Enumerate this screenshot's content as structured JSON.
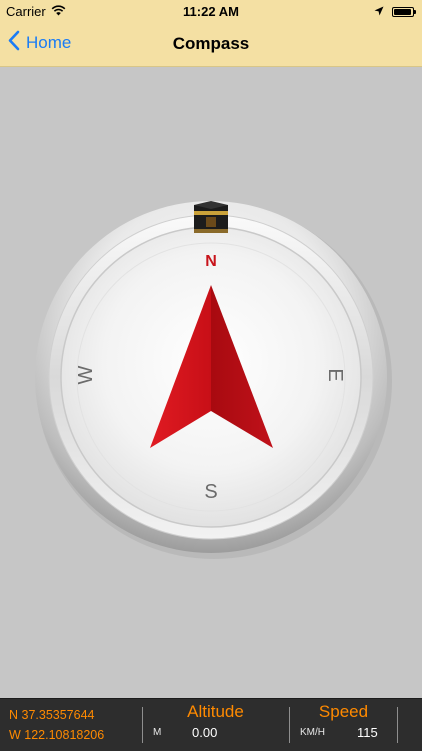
{
  "status_bar": {
    "carrier": "Carrier",
    "time": "11:22 AM",
    "battery_level": 0.95,
    "icons": [
      "wifi-icon",
      "location-arrow-icon",
      "battery-icon"
    ]
  },
  "nav": {
    "back_label": "Home",
    "title": "Compass",
    "back_icon": "chevron-left-icon"
  },
  "compass": {
    "north": "N",
    "east": "E",
    "south": "S",
    "west": "W",
    "kaaba_icon": "kaaba-icon",
    "needle_color": "#d3131b",
    "north_label_color": "#c8141b"
  },
  "info": {
    "latitude": "N 37.35357644",
    "longitude": "W 122.10818206",
    "altitude_title": "Altitude",
    "altitude_unit": "M",
    "altitude_value": "0.00",
    "speed_title": "Speed",
    "speed_unit": "KM/H",
    "speed_value": "115",
    "accent_color": "#ff8a00"
  }
}
